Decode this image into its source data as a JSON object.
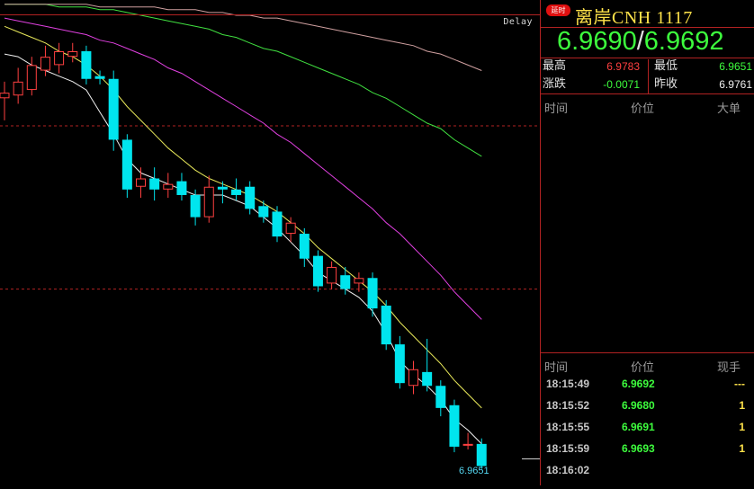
{
  "chart_label": "Delay",
  "last_price_label": "6.9651",
  "panel": {
    "badge": "延时",
    "title": "离岸CNH 1117",
    "bid": "6.9690",
    "ask": "6.9692",
    "stats": {
      "high_label": "最高",
      "high": "6.9783",
      "low_label": "最低",
      "low": "6.9651",
      "change_label": "涨跌",
      "change": "-0.0071",
      "prev_close_label": "昨收",
      "prev_close": "6.9761"
    },
    "big_trades_header": {
      "time": "时间",
      "price": "价位",
      "vol": "大单"
    },
    "trades_header": {
      "time": "时间",
      "price": "价位",
      "vol": "现手"
    },
    "trades": [
      {
        "time": "18:15:49",
        "price": "6.9692",
        "vol": "---"
      },
      {
        "time": "18:15:52",
        "price": "6.9680",
        "vol": "1"
      },
      {
        "time": "18:15:55",
        "price": "6.9691",
        "vol": "1"
      },
      {
        "time": "18:15:59",
        "price": "6.9693",
        "vol": "1"
      },
      {
        "time": "18:16:02",
        "price": "",
        "vol": ""
      }
    ]
  },
  "colors": {
    "up": "#ff4040",
    "down": "#00e5ee",
    "ma1": "#f0f0f0",
    "ma2": "#e8e85a",
    "ma3": "#e040e0",
    "ma4": "#40e040",
    "ma5": "#d0a0a0",
    "grid": "#b22222"
  },
  "chart_data": {
    "type": "candlestick",
    "y_range": [
      6.9645,
      6.9815
    ],
    "candles": [
      {
        "o": 6.9785,
        "c": 6.9787,
        "h": 6.9791,
        "l": 6.9777
      },
      {
        "o": 6.9786,
        "c": 6.9791,
        "h": 6.9796,
        "l": 6.9783
      },
      {
        "o": 6.9788,
        "c": 6.9797,
        "h": 6.98,
        "l": 6.9786
      },
      {
        "o": 6.9795,
        "c": 6.98,
        "h": 6.9804,
        "l": 6.9793
      },
      {
        "o": 6.9797,
        "c": 6.9802,
        "h": 6.9805,
        "l": 6.9794
      },
      {
        "o": 6.98,
        "c": 6.9802,
        "h": 6.9805,
        "l": 6.9798
      },
      {
        "o": 6.9802,
        "c": 6.9792,
        "h": 6.9804,
        "l": 6.979
      },
      {
        "o": 6.9793,
        "c": 6.9792,
        "h": 6.9795,
        "l": 6.979
      },
      {
        "o": 6.9792,
        "c": 6.977,
        "h": 6.9795,
        "l": 6.9766
      },
      {
        "o": 6.977,
        "c": 6.9752,
        "h": 6.9772,
        "l": 6.9749
      },
      {
        "o": 6.9753,
        "c": 6.9756,
        "h": 6.976,
        "l": 6.9749
      },
      {
        "o": 6.9756,
        "c": 6.9752,
        "h": 6.976,
        "l": 6.9748
      },
      {
        "o": 6.9752,
        "c": 6.9754,
        "h": 6.9758,
        "l": 6.9749
      },
      {
        "o": 6.9755,
        "c": 6.975,
        "h": 6.9758,
        "l": 6.9748
      },
      {
        "o": 6.975,
        "c": 6.9742,
        "h": 6.9752,
        "l": 6.9739
      },
      {
        "o": 6.9742,
        "c": 6.9753,
        "h": 6.9757,
        "l": 6.974
      },
      {
        "o": 6.9753,
        "c": 6.9752,
        "h": 6.9755,
        "l": 6.9747
      },
      {
        "o": 6.9752,
        "c": 6.975,
        "h": 6.9756,
        "l": 6.9748
      },
      {
        "o": 6.9753,
        "c": 6.9745,
        "h": 6.9755,
        "l": 6.9743
      },
      {
        "o": 6.9746,
        "c": 6.9742,
        "h": 6.9748,
        "l": 6.974
      },
      {
        "o": 6.9744,
        "c": 6.9735,
        "h": 6.9746,
        "l": 6.9733
      },
      {
        "o": 6.9736,
        "c": 6.974,
        "h": 6.9742,
        "l": 6.9733
      },
      {
        "o": 6.9736,
        "c": 6.9727,
        "h": 6.9738,
        "l": 6.9724
      },
      {
        "o": 6.9728,
        "c": 6.9717,
        "h": 6.973,
        "l": 6.9715
      },
      {
        "o": 6.9718,
        "c": 6.9724,
        "h": 6.9726,
        "l": 6.9716
      },
      {
        "o": 6.9721,
        "c": 6.9716,
        "h": 6.9724,
        "l": 6.9714
      },
      {
        "o": 6.9718,
        "c": 6.972,
        "h": 6.9722,
        "l": 6.9715
      },
      {
        "o": 6.972,
        "c": 6.9709,
        "h": 6.9722,
        "l": 6.9706
      },
      {
        "o": 6.971,
        "c": 6.9696,
        "h": 6.9712,
        "l": 6.9694
      },
      {
        "o": 6.9696,
        "c": 6.9682,
        "h": 6.9699,
        "l": 6.968
      },
      {
        "o": 6.9681,
        "c": 6.9687,
        "h": 6.969,
        "l": 6.9678
      },
      {
        "o": 6.9686,
        "c": 6.9681,
        "h": 6.9698,
        "l": 6.9679
      },
      {
        "o": 6.9681,
        "c": 6.9673,
        "h": 6.9683,
        "l": 6.967
      },
      {
        "o": 6.9674,
        "c": 6.9659,
        "h": 6.9676,
        "l": 6.9657
      },
      {
        "o": 6.966,
        "c": 6.966,
        "h": 6.9664,
        "l": 6.9658
      },
      {
        "o": 6.966,
        "c": 6.9652,
        "h": 6.9662,
        "l": 6.9651
      }
    ],
    "ma_lines": [
      {
        "name": "ma1",
        "values": [
          6.9801,
          6.98,
          6.9797,
          6.9795,
          6.9793,
          6.9791,
          6.9788,
          6.978,
          6.9772,
          6.9763,
          6.9758,
          6.9756,
          6.9754,
          6.9752,
          6.975,
          6.975,
          6.975,
          6.9748,
          6.9746,
          6.9742,
          6.9738,
          6.9733,
          6.9728,
          6.9722,
          6.9719,
          6.9716,
          6.9713,
          6.9708,
          6.97,
          6.969,
          6.9685,
          6.9681,
          6.9676,
          6.9669,
          6.9665,
          6.966
        ]
      },
      {
        "name": "ma2",
        "values": [
          6.9811,
          6.9809,
          6.9807,
          6.9805,
          6.9802,
          6.98,
          6.9797,
          6.9793,
          6.9788,
          6.9782,
          6.9777,
          6.9772,
          6.9767,
          6.9763,
          6.9759,
          6.9756,
          6.9754,
          6.9752,
          6.975,
          6.9747,
          6.9744,
          6.974,
          6.9736,
          6.9731,
          6.9727,
          6.9723,
          6.9719,
          6.9715,
          6.971,
          6.9704,
          6.9699,
          6.9694,
          6.9689,
          6.9683,
          6.9678,
          6.9673
        ]
      },
      {
        "name": "ma3",
        "values": [
          6.9814,
          6.9813,
          6.9812,
          6.9811,
          6.981,
          6.9809,
          6.9808,
          6.9806,
          6.9805,
          6.9803,
          6.9801,
          6.9799,
          6.9796,
          6.9794,
          6.9791,
          6.9788,
          6.9785,
          6.9782,
          6.9779,
          6.9776,
          6.9772,
          6.9769,
          6.9765,
          6.9761,
          6.9757,
          6.9753,
          6.9749,
          6.9745,
          6.974,
          6.9736,
          6.9731,
          6.9726,
          6.9721,
          6.9715,
          6.971,
          6.9705
        ]
      },
      {
        "name": "ma4",
        "values": [
          6.9819,
          6.9819,
          6.9819,
          6.9819,
          6.9818,
          6.9818,
          6.9818,
          6.9817,
          6.9817,
          6.9816,
          6.9815,
          6.9814,
          6.9813,
          6.9812,
          6.9811,
          6.981,
          6.9808,
          6.9807,
          6.9805,
          6.9803,
          6.9802,
          6.98,
          6.9798,
          6.9796,
          6.9794,
          6.9792,
          6.979,
          6.9787,
          6.9785,
          6.9782,
          6.9779,
          6.9776,
          6.9774,
          6.977,
          6.9767,
          6.9764
        ]
      },
      {
        "name": "ma5",
        "values": [
          6.9819,
          6.9819,
          6.9819,
          6.9819,
          6.9819,
          6.9819,
          6.9819,
          6.9818,
          6.9818,
          6.9818,
          6.9818,
          6.9818,
          6.9817,
          6.9817,
          6.9817,
          6.9816,
          6.9816,
          6.9815,
          6.9815,
          6.9814,
          6.9814,
          6.9813,
          6.9812,
          6.9811,
          6.981,
          6.9809,
          6.9808,
          6.9807,
          6.9806,
          6.9805,
          6.9804,
          6.9802,
          6.9801,
          6.9799,
          6.9797,
          6.9795
        ]
      }
    ],
    "reference_lines": [
      6.9775,
      6.9716
    ]
  }
}
